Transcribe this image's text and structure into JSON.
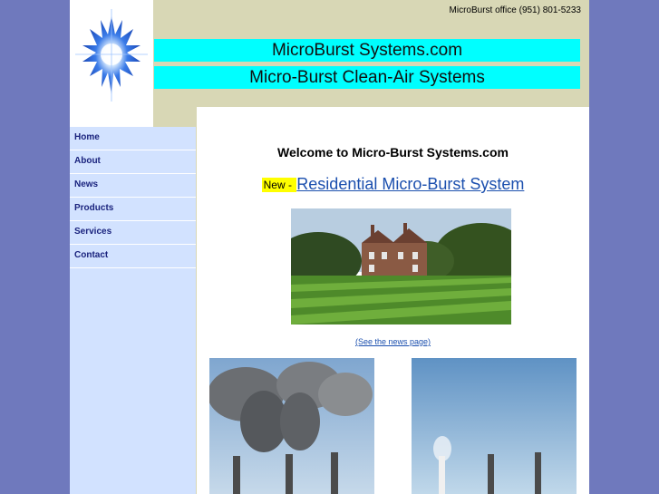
{
  "header": {
    "office_phone": "MicroBurst office (951) 801-5233",
    "banner_title": "MicroBurst Systems.com",
    "banner_subtitle": "Micro-Burst Clean-Air Systems"
  },
  "sidebar": {
    "items": [
      {
        "label": "Home"
      },
      {
        "label": "About"
      },
      {
        "label": "News"
      },
      {
        "label": "Products"
      },
      {
        "label": "Services"
      },
      {
        "label": "Contact"
      }
    ]
  },
  "main": {
    "welcome": "Welcome to Micro-Burst Systems.com",
    "new_badge": "New - ",
    "headline_link": "Residential Micro-Burst System",
    "news_link": "(See the news page)"
  },
  "colors": {
    "page_background": "#6f79bd",
    "header_background": "#d8d7b5",
    "banner": "#00ffff",
    "sidebar": "#d2e2ff",
    "new_badge": "#ffff00",
    "link": "#1b4fae"
  },
  "icons": {
    "logo": "starburst-logo",
    "house_photo": "country-house-lawn-photo",
    "smoke_photo": "smokestacks-photo"
  }
}
